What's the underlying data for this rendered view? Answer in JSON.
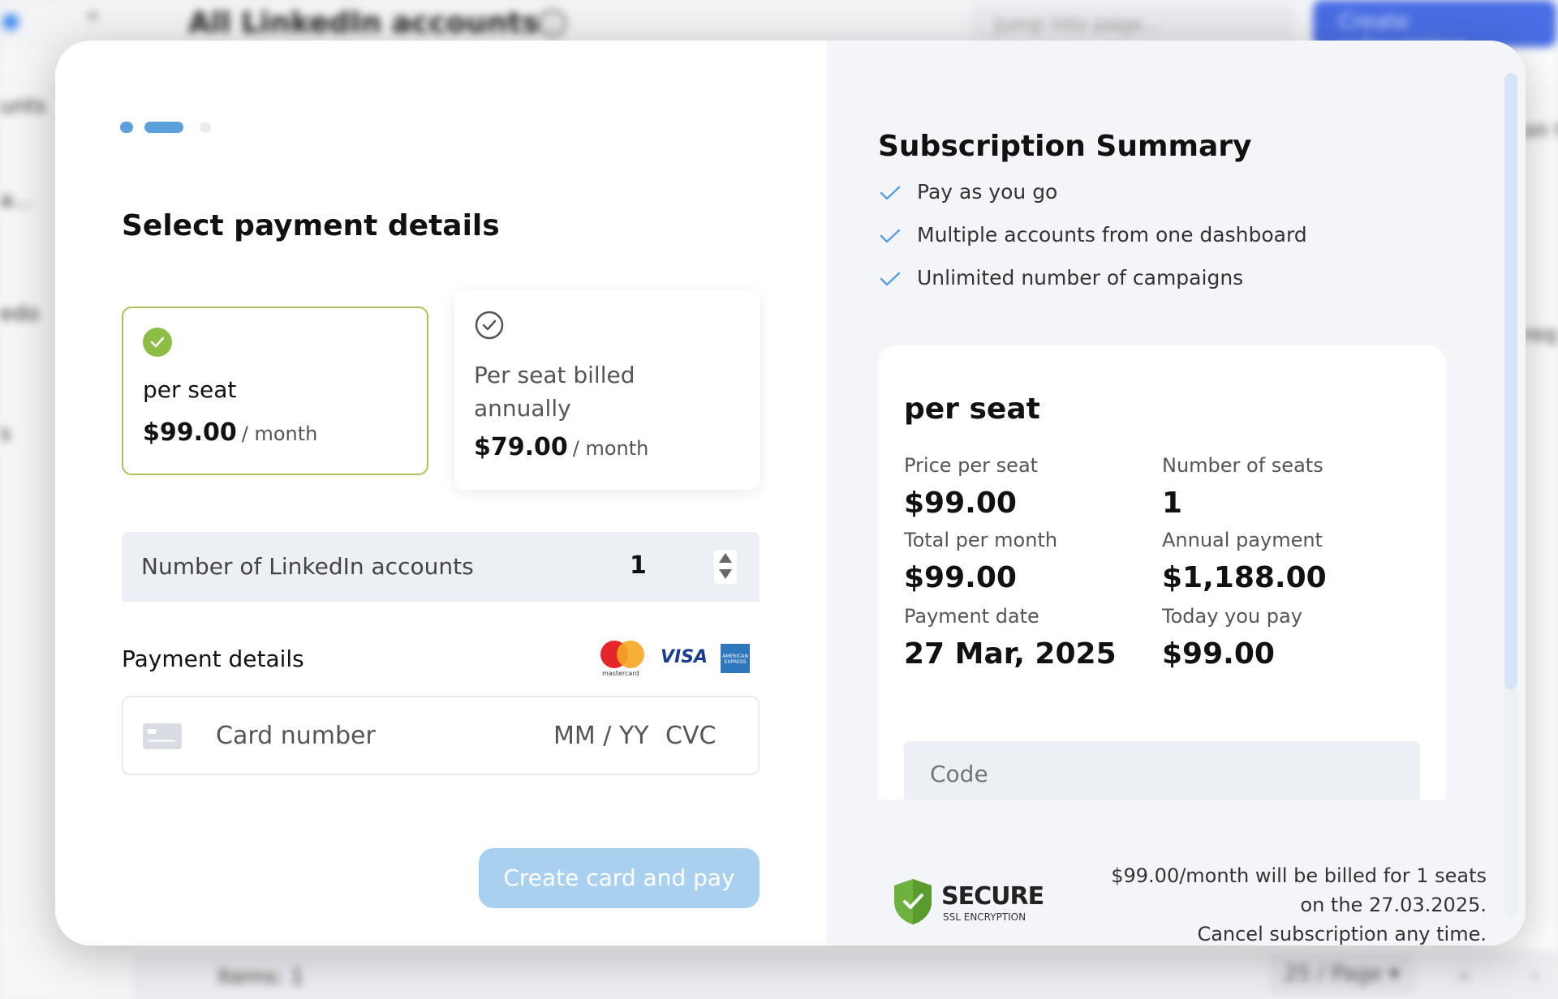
{
  "background": {
    "title": "All LinkedIn accounts",
    "search_placeholder": "Jump into page...",
    "create_button": "Create subscription",
    "sidebar_items": [
      "unts",
      "a...",
      "edo",
      "s"
    ],
    "right_fragments": [
      "on t",
      "req"
    ],
    "footer": {
      "items": "Items: 1",
      "page_size": "25 / Page"
    }
  },
  "steps": {
    "total": 3,
    "active": 2
  },
  "left": {
    "title": "Select payment details",
    "plans": [
      {
        "name": "per seat",
        "price": "$99.00",
        "period": "/ month",
        "selected": true
      },
      {
        "name": "Per seat billed annually",
        "price": "$79.00",
        "period": "/ month",
        "selected": false
      }
    ],
    "seats": {
      "label": "Number of LinkedIn accounts",
      "value": "1"
    },
    "payment": {
      "label": "Payment details",
      "mastercard_text": "mastercard",
      "visa_text": "VISA",
      "amex_text": "AMERICAN EXPRESS",
      "card_placeholder": "Card number",
      "expiry_placeholder": "MM / YY",
      "cvc_placeholder": "CVC"
    },
    "submit": "Create card and pay"
  },
  "summary": {
    "title": "Subscription Summary",
    "features": [
      "Pay as you go",
      "Multiple accounts from one dashboard",
      "Unlimited number of campaigns"
    ],
    "plan_name": "per seat",
    "price_per_seat_label": "Price per seat",
    "price_per_seat": "$99.00",
    "seats_label": "Number of seats",
    "seats": "1",
    "total_month_label": "Total per month",
    "total_month": "$99.00",
    "annual_label": "Annual payment",
    "annual": "$1,188.00",
    "date_label": "Payment date",
    "date": "27 Mar, 2025",
    "today_label": "Today you pay",
    "today": "$99.00",
    "code_placeholder": "Code"
  },
  "secure": {
    "title": "SECURE",
    "subtitle": "SSL ENCRYPTION"
  },
  "billing_note": [
    "$99.00/month will be billed for 1 seats",
    "on the 27.03.2025.",
    "Cancel subscription any time."
  ],
  "colors": {
    "accent": "#5b9fdb",
    "button": "#a9d0ee",
    "selected_border": "#a9c25c",
    "check": "#8dbd45"
  }
}
